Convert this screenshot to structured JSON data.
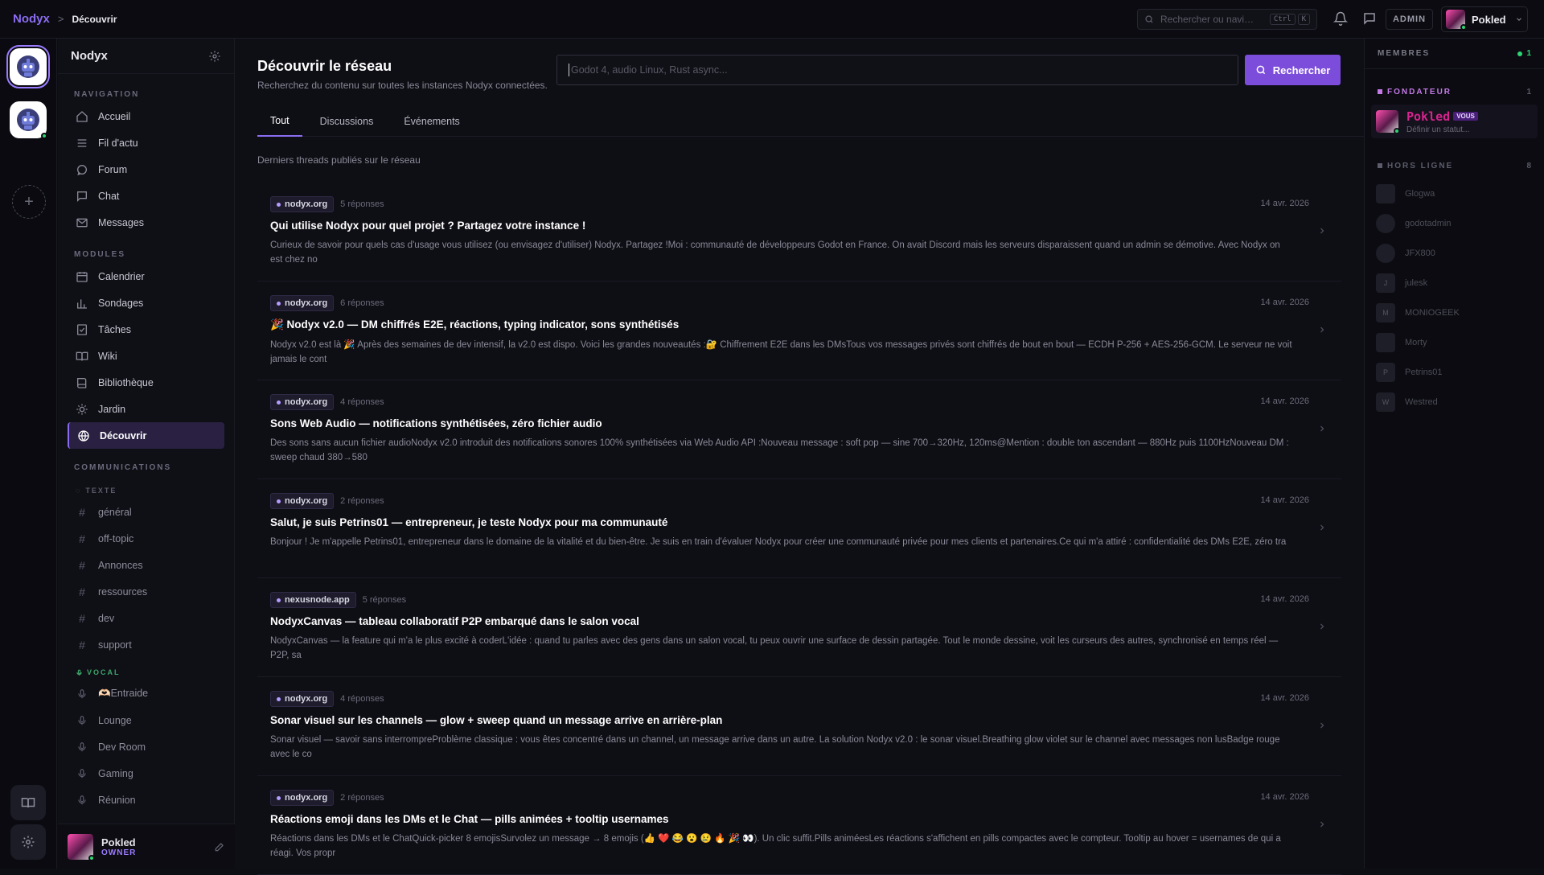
{
  "topbar": {
    "brand": "Nodyx",
    "breadcrumb_sep": ">",
    "breadcrumb_current": "Découvrir",
    "search_placeholder": "Rechercher ou navi…",
    "kbd": [
      "Ctrl",
      "K"
    ],
    "admin_label": "ADMIN",
    "user_name": "Pokled"
  },
  "rail": {
    "add_label": "+"
  },
  "sidebar": {
    "title": "Nodyx",
    "nav_title": "NAVIGATION",
    "nav": [
      {
        "label": "Accueil",
        "icon": "home-icon"
      },
      {
        "label": "Fil d'actu",
        "icon": "feed-icon"
      },
      {
        "label": "Forum",
        "icon": "forum-icon"
      },
      {
        "label": "Chat",
        "icon": "chat-icon"
      },
      {
        "label": "Messages",
        "icon": "mail-icon"
      }
    ],
    "modules_title": "MODULES",
    "modules": [
      {
        "label": "Calendrier",
        "icon": "calendar-icon"
      },
      {
        "label": "Sondages",
        "icon": "poll-icon"
      },
      {
        "label": "Tâches",
        "icon": "tasks-icon"
      },
      {
        "label": "Wiki",
        "icon": "wiki-icon"
      },
      {
        "label": "Bibliothèque",
        "icon": "library-icon"
      },
      {
        "label": "Jardin",
        "icon": "garden-icon"
      },
      {
        "label": "Découvrir",
        "icon": "discover-icon",
        "active": true
      }
    ],
    "comms_title": "COMMUNICATIONS",
    "text_title": "TEXTE",
    "text_channels": [
      "général",
      "off-topic",
      "Annonces",
      "ressources",
      "dev",
      "support"
    ],
    "vocal_title": "VOCAL",
    "vocal_channels": [
      "🫶🏻Entraide",
      "Lounge",
      "Dev Room",
      "Gaming",
      "Réunion"
    ],
    "footer": {
      "name": "Pokled",
      "role": "OWNER"
    }
  },
  "main": {
    "title": "Découvrir le réseau",
    "subtitle": "Recherchez du contenu sur toutes les instances Nodyx connectées.",
    "search_placeholder": "Godot 4, audio Linux, Rust async...",
    "search_button": "Rechercher",
    "tabs": [
      "Tout",
      "Discussions",
      "Événements"
    ],
    "caption": "Derniers threads publiés sur le réseau",
    "threads": [
      {
        "instance": "nodyx.org",
        "replies": "5 réponses",
        "date": "14 avr. 2026",
        "title": "Qui utilise Nodyx pour quel projet ? Partagez votre instance !",
        "excerpt": "Curieux de savoir pour quels cas d'usage vous utilisez (ou envisagez d'utiliser) Nodyx. Partagez !Moi : communauté de développeurs Godot en France. On avait Discord mais les serveurs disparaissent quand un admin se démotive. Avec Nodyx on est chez no"
      },
      {
        "instance": "nodyx.org",
        "replies": "6 réponses",
        "date": "14 avr. 2026",
        "title": "🎉 Nodyx v2.0 — DM chiffrés E2E, réactions, typing indicator, sons synthétisés",
        "excerpt": "Nodyx v2.0 est là 🎉 Après des semaines de dev intensif, la v2.0 est dispo. Voici les grandes nouveautés :🔐 Chiffrement E2E dans les DMsTous vos messages privés sont chiffrés de bout en bout — ECDH P-256 + AES-256-GCM. Le serveur ne voit jamais le cont"
      },
      {
        "instance": "nodyx.org",
        "replies": "4 réponses",
        "date": "14 avr. 2026",
        "title": "Sons Web Audio — notifications synthétisées, zéro fichier audio",
        "excerpt": "Des sons sans aucun fichier audioNodyx v2.0 introduit des notifications sonores 100% synthétisées via Web Audio API :Nouveau message : soft pop — sine 700→320Hz, 120ms@Mention : double ton ascendant — 880Hz puis 1100HzNouveau DM : sweep chaud 380→580"
      },
      {
        "instance": "nodyx.org",
        "replies": "2 réponses",
        "date": "14 avr. 2026",
        "title": "Salut, je suis Petrins01 — entrepreneur, je teste Nodyx pour ma communauté",
        "excerpt": "Bonjour ! Je m'appelle Petrins01, entrepreneur dans le domaine de la vitalité et du bien-être. Je suis en train d'évaluer Nodyx pour créer une communauté privée pour mes clients et partenaires.Ce qui m'a attiré : confidentialité des DMs E2E, zéro tra"
      },
      {
        "instance": "nexusnode.app",
        "replies": "5 réponses",
        "date": "14 avr. 2026",
        "title": "NodyxCanvas — tableau collaboratif P2P embarqué dans le salon vocal",
        "excerpt": "NodyxCanvas — la feature qui m'a le plus excité à coderL'idée : quand tu parles avec des gens dans un salon vocal, tu peux ouvrir une surface de dessin partagée. Tout le monde dessine, voit les curseurs des autres, synchronisé en temps réel — P2P, sa"
      },
      {
        "instance": "nodyx.org",
        "replies": "4 réponses",
        "date": "14 avr. 2026",
        "title": "Sonar visuel sur les channels — glow + sweep quand un message arrive en arrière-plan",
        "excerpt": "Sonar visuel — savoir sans interrompreProblème classique : vous êtes concentré dans un channel, un message arrive dans un autre. La solution Nodyx v2.0 : le sonar visuel.Breathing glow violet sur le channel avec messages non lusBadge rouge avec le co"
      },
      {
        "instance": "nodyx.org",
        "replies": "2 réponses",
        "date": "14 avr. 2026",
        "title": "Réactions emoji dans les DMs et le Chat — pills animées + tooltip usernames",
        "excerpt": "Réactions dans les DMs et le ChatQuick-picker 8 emojisSurvolez un message → 8 emojis (👍 ❤️ 😂 😮 😢 🔥 🎉 👀). Un clic suffit.Pills animéesLes réactions s'affichent en pills compactes avec le compteur. Tooltip au hover = usernames de qui a réagi. Vos propr"
      }
    ]
  },
  "members": {
    "title": "MEMBRES",
    "online_count": "1",
    "founder_group": "FONDATEUR",
    "founder_count": "1",
    "me": {
      "name": "Pokled",
      "tag": "VOUS",
      "status": "Définir un statut..."
    },
    "offline_group": "HORS LIGNE",
    "offline_count": "8",
    "offline": [
      {
        "name": "Glogwa",
        "initial": ""
      },
      {
        "name": "godotadmin",
        "initial": ""
      },
      {
        "name": "JFX800",
        "initial": ""
      },
      {
        "name": "julesk",
        "initial": "J"
      },
      {
        "name": "MONIOGEEK",
        "initial": "M"
      },
      {
        "name": "Morty",
        "initial": ""
      },
      {
        "name": "Petrins01",
        "initial": "P"
      },
      {
        "name": "Westred",
        "initial": "W"
      }
    ]
  },
  "colors": {
    "accent": "#7c4ddb",
    "online": "#2ed573",
    "founder": "#d6248e"
  }
}
